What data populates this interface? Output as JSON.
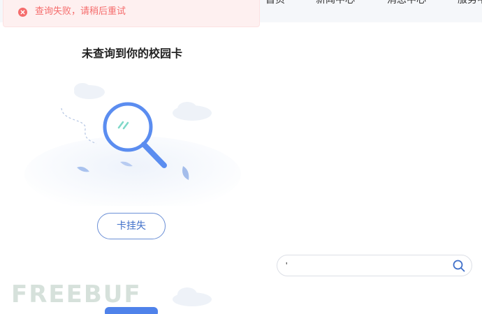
{
  "nav": {
    "items": [
      "首页",
      "新闻中心",
      "消息中心",
      "服务中心"
    ]
  },
  "toast": {
    "message": "查询失败，请稍后重试",
    "icon": "error-circle-icon",
    "color": "#f56c6c"
  },
  "panel": {
    "title": "未查询到你的校园卡",
    "illustration_icon": "magnifier-empty-icon",
    "lost_button_label": "卡挂失"
  },
  "search": {
    "value": "'",
    "icon": "search-icon"
  },
  "watermark": "FREEBUF",
  "colors": {
    "accent": "#3f6fc9",
    "magnifier": "#5b8df0"
  }
}
